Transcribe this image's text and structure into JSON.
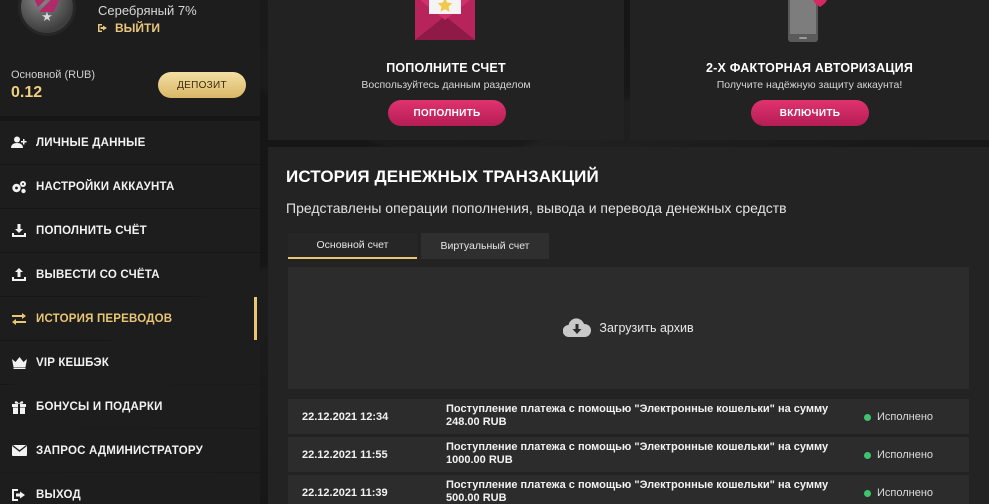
{
  "profile": {
    "level_text": "Серебряный 7%",
    "logout_label": "ВЫЙТИ",
    "balance_label": "Основной (RUB)",
    "balance_value": "0.12",
    "deposit_button": "ДЕПОЗИТ"
  },
  "menu": [
    {
      "label": "ЛИЧНЫЕ ДАННЫЕ",
      "icon": "user-plus-icon"
    },
    {
      "label": "НАСТРОЙКИ АККАУНТА",
      "icon": "gears-icon"
    },
    {
      "label": "ПОПОЛНИТЬ СЧЁТ",
      "icon": "download-icon"
    },
    {
      "label": "ВЫВЕСТИ СО СЧЁТА",
      "icon": "upload-icon"
    },
    {
      "label": "ИСТОРИЯ ПЕРЕВОДОВ",
      "icon": "exchange-icon",
      "active": true
    },
    {
      "label": "VIP КЕШБЭК",
      "icon": "crown-icon"
    },
    {
      "label": "БОНУСЫ И ПОДАРКИ",
      "icon": "gift-icon"
    },
    {
      "label": "ЗАПРОС АДМИНИСТРАТОРУ",
      "icon": "envelope-icon"
    },
    {
      "label": "ВЫХОД",
      "icon": "logout-icon"
    }
  ],
  "cards": {
    "deposit": {
      "title": "ПОПОЛНИТЕ СЧЕТ",
      "subtitle": "Воспользуйтесь данным разделом",
      "button": "ПОПОЛНИТЬ"
    },
    "twofa": {
      "title": "2-Х ФАКТОРНАЯ АВТОРИЗАЦИЯ",
      "subtitle": "Получите надёжную защиту аккаунта!",
      "button": "ВКЛЮЧИТЬ"
    }
  },
  "history": {
    "title": "ИСТОРИЯ ДЕНЕЖНЫХ ТРАНЗАКЦИЙ",
    "subtitle": "Представлены операции пополнения, вывода и перевода денежных средств",
    "tabs": [
      "Основной счет",
      "Виртуальный счет"
    ],
    "archive_label": "Загрузить архив",
    "rows": [
      {
        "date": "22.12.2021 12:34",
        "description": "Поступление платежа с помощью \"Электронные кошельки\" на сумму 248.00 RUB",
        "status": "Исполнено"
      },
      {
        "date": "22.12.2021 11:55",
        "description": "Поступление платежа с помощью \"Электронные кошельки\" на сумму 1000.00 RUB",
        "status": "Исполнено"
      },
      {
        "date": "22.12.2021 11:39",
        "description": "Поступление платежа с помощью \"Электронные кошельки\" на сумму 500.00 RUB",
        "status": "Исполнено"
      }
    ]
  },
  "colors": {
    "accent_gold": "#e9c674",
    "accent_pink": "#d42a64",
    "status_green": "#3ec46d"
  }
}
